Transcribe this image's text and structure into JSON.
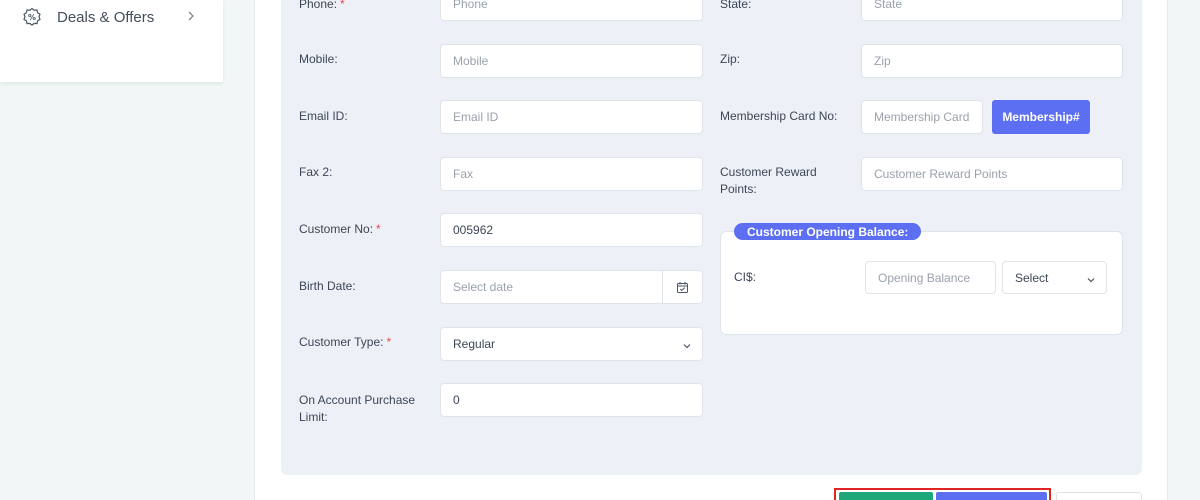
{
  "sidebar": {
    "deals_item": {
      "label": "Deals & Offers",
      "icon": "discount-badge-icon"
    }
  },
  "form": {
    "left": [
      {
        "label": "Phone:",
        "required": "*",
        "placeholder": "Phone",
        "value": ""
      },
      {
        "label": "Mobile:",
        "placeholder": "Mobile",
        "value": ""
      },
      {
        "label": "Email ID:",
        "placeholder": "Email ID",
        "value": ""
      },
      {
        "label": "Fax 2:",
        "placeholder": "Fax",
        "value": ""
      },
      {
        "label": "Customer No:",
        "required": "*",
        "value": "005962"
      },
      {
        "label": "Birth Date:",
        "placeholder": "Select date",
        "value": ""
      },
      {
        "label": "Customer Type:",
        "required": "*",
        "value": "Regular"
      },
      {
        "label": "On Account Purchase Limit:",
        "value": "0"
      }
    ],
    "right": [
      {
        "label": "State:",
        "placeholder": "State",
        "value": ""
      },
      {
        "label": "Zip:",
        "placeholder": "Zip",
        "value": ""
      },
      {
        "label": "Membership Card No:",
        "placeholder": "Membership Card",
        "value": "",
        "button": "Membership#"
      },
      {
        "label": "Customer Reward Points:",
        "placeholder": "Customer Reward Points",
        "value": ""
      }
    ],
    "opening_balance": {
      "title": "Customer Opening Balance:",
      "currency_label": "CI$:",
      "placeholder": "Opening Balance",
      "select_value": "Select"
    }
  },
  "colors": {
    "accent": "#5c6ef2",
    "success": "#1ea779",
    "required": "#e5484d",
    "highlight": "#e02424",
    "panel": "#eef0f8",
    "page_bg": "#f0f7f6"
  }
}
